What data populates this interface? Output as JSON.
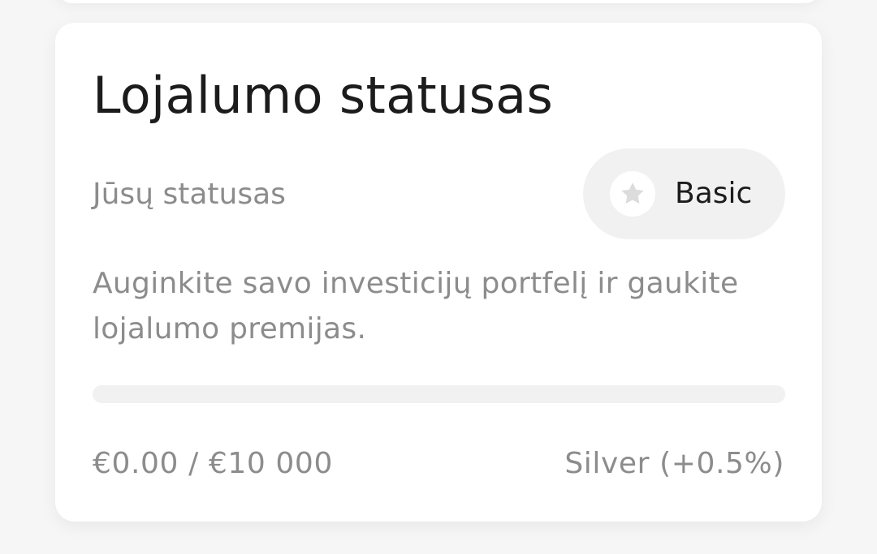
{
  "loyalty_card": {
    "title": "Lojalumo statusas",
    "status_label": "Jūsų statusas",
    "status_value": "Basic",
    "status_icon": "star-icon",
    "description": "Auginkite savo investicijų portfelį ir gaukite lojalumo premijas.",
    "progress": {
      "fraction": 0.0,
      "amount_text": "€0.00 / €10 000",
      "next_tier_text": "Silver (+0.5%)"
    }
  }
}
